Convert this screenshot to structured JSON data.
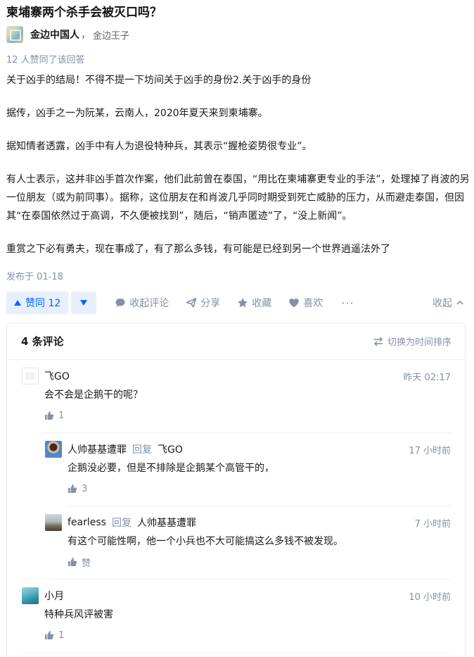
{
  "question": {
    "title": "柬埔寨两个杀手会被灭口吗？"
  },
  "author": {
    "name": "金边中国人",
    "separator": "，",
    "bio": "金边王子"
  },
  "answer": {
    "voters_text": "12 人赞同了该回答",
    "paragraphs": [
      "关于凶手的结局！不得不提一下坊间关于凶手的身份2.关于凶手的身份",
      "据传，凶手之一为阮某，云南人，2020年夏天来到柬埔寨。",
      "据知情者透露，凶手中有人为退役特种兵，其表示“握枪姿势很专业”。",
      "有人士表示，这并非凶手首次作案，他们此前曾在泰国，“用比在柬埔寨更专业的手法”，处理掉了肖波的另一位朋友（或为前同事）。据称，这位朋友在和肖波几乎同时期受到死亡威胁的压力，从而避走泰国，但因其“在泰国依然过于高调，不久便被找到”，随后，“销声匿迹”了，“没上新闻”。",
      "重赏之下必有勇夫，现在事成了，有了那么多钱，有可能是已经到另一个世界逍遥法外了"
    ],
    "published": "发布于 01-18"
  },
  "actions": {
    "upvote_label": "赞同 12",
    "collapse_comments": "收起评论",
    "share": "分享",
    "favorite": "收藏",
    "like": "喜欢",
    "more": "···",
    "collapse": "收起"
  },
  "comments": {
    "count_label": "4 条评论",
    "sort_label": "切换为时间排序",
    "items": [
      {
        "name": "飞GO",
        "reply_word": "",
        "reply_to": "",
        "time": "昨天 02:17",
        "text": "会不会是企鹅干的呢？",
        "likes": "1"
      },
      {
        "name": "人帅基基遭罪",
        "reply_word": "回复",
        "reply_to": "飞GO",
        "time": "17 小时前",
        "text": "企鹅没必要，但是不排除是企鹅某个高管干的，",
        "likes": "3"
      },
      {
        "name": "fearless",
        "reply_word": "回复",
        "reply_to": "人帅基基遭罪",
        "time": "7 小时前",
        "text": "有这个可能性啊，他一个小兵也不大可能搞这么多钱不被发现。",
        "likes": "赞"
      },
      {
        "name": "小月",
        "reply_word": "",
        "reply_to": "",
        "time": "10 小时前",
        "text": "特种兵风评被害",
        "likes": "1"
      }
    ]
  },
  "colors": {
    "accent": "#0066ff",
    "accent_bg": "#e8f0ff",
    "muted": "#8590a6"
  }
}
